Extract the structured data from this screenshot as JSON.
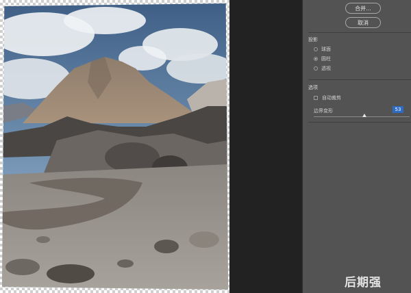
{
  "actions": {
    "merge_label": "合并...",
    "cancel_label": "取消"
  },
  "projection": {
    "title": "投影",
    "options": [
      {
        "label": "球面",
        "selected": false
      },
      {
        "label": "圆柱",
        "selected": true
      },
      {
        "label": "透视",
        "selected": false
      }
    ]
  },
  "options": {
    "title": "选项",
    "auto_crop_label": "自动裁剪",
    "auto_crop_checked": false,
    "boundary_warp_label": "边界变形",
    "boundary_warp_value": "53",
    "boundary_warp_max": 100
  },
  "watermark": "后期强",
  "colors": {
    "panel_bg": "#535353",
    "canvas_bg": "#252525",
    "accent": "#2d6bc4"
  }
}
